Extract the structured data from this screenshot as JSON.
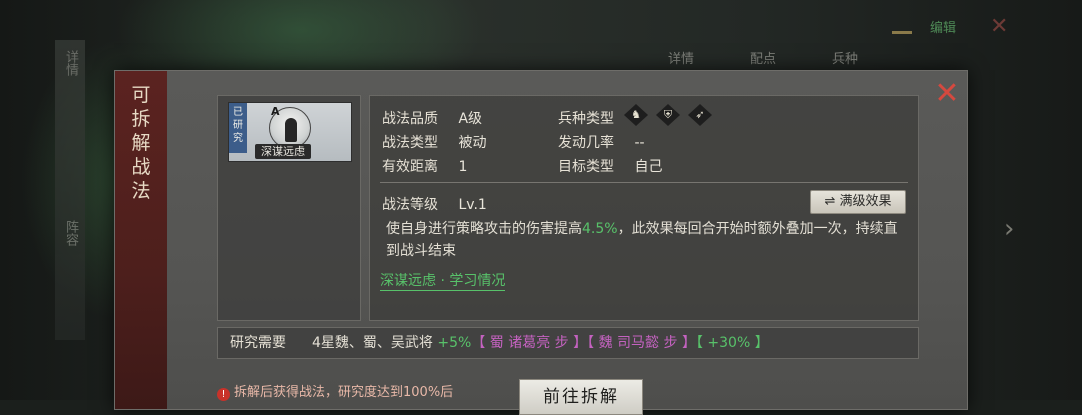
{
  "background": {
    "left_strip": [
      "详情",
      "阵容"
    ],
    "top_tabs": [
      "详情",
      "配点",
      "兵种"
    ],
    "top_right_text": "编辑"
  },
  "dialog": {
    "side_title": "可拆解战法",
    "close_symbol": "✕"
  },
  "card": {
    "researched_tag": "已研究",
    "grade": "A",
    "name": "深谋远虑"
  },
  "info": {
    "quality_label": "战法品质",
    "quality_value": "A级",
    "type_label": "战法类型",
    "type_value": "被动",
    "range_label": "有效距离",
    "range_value": "1",
    "troop_label": "兵种类型",
    "troop_icons": [
      "cavalry-icon",
      "shield-icon",
      "bow-icon"
    ],
    "rate_label": "发动几率",
    "rate_value": "--",
    "target_label": "目标类型",
    "target_value": "自己",
    "level_label": "战法等级",
    "level_value": "Lv.1",
    "max_button": "⇌ 满级效果",
    "desc_before": "使自身进行策略攻击的伤害提高",
    "desc_highlight": "4.5%",
    "desc_after": "，此效果每回合开始时额外叠加一次，持续直到战斗结束",
    "learn_link": "深谋远虑 · 学习情况"
  },
  "requirement": {
    "label": "研究需要",
    "text": "4星魏、蜀、吴武将",
    "bonus1": "+5%",
    "bracket1": "【 蜀 诸葛亮 步 】",
    "bracket2": "【 魏 司马懿 步 】",
    "bonus2": "【 +30% 】"
  },
  "bottom": {
    "warning": "拆解后获得战法，研究度达到100%后",
    "goto_button": "前往拆解"
  },
  "colors": {
    "highlight_green": "#58c26a",
    "close_red": "#d5493f",
    "side_red": "#5b2320"
  }
}
